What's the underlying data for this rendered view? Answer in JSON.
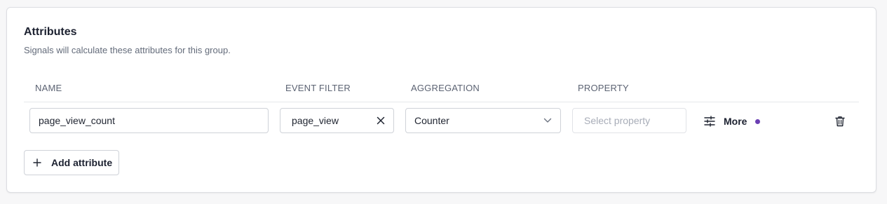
{
  "section": {
    "title": "Attributes",
    "subtitle": "Signals will calculate these attributes for this group."
  },
  "table": {
    "headers": {
      "name": "NAME",
      "event_filter": "EVENT FILTER",
      "aggregation": "AGGREGATION",
      "property": "PROPERTY"
    },
    "rows": [
      {
        "name": "page_view_count",
        "event_filter": "page_view",
        "aggregation": "Counter",
        "property_placeholder": "Select property",
        "more_label": "More",
        "more_indicator_color": "#6b3fb3"
      }
    ]
  },
  "actions": {
    "add_attribute_label": "Add attribute"
  },
  "icons": {
    "clear": "close-icon",
    "dropdown": "chevron-down-icon",
    "more": "sliders-icon",
    "delete": "trash-icon",
    "add": "plus-icon"
  }
}
